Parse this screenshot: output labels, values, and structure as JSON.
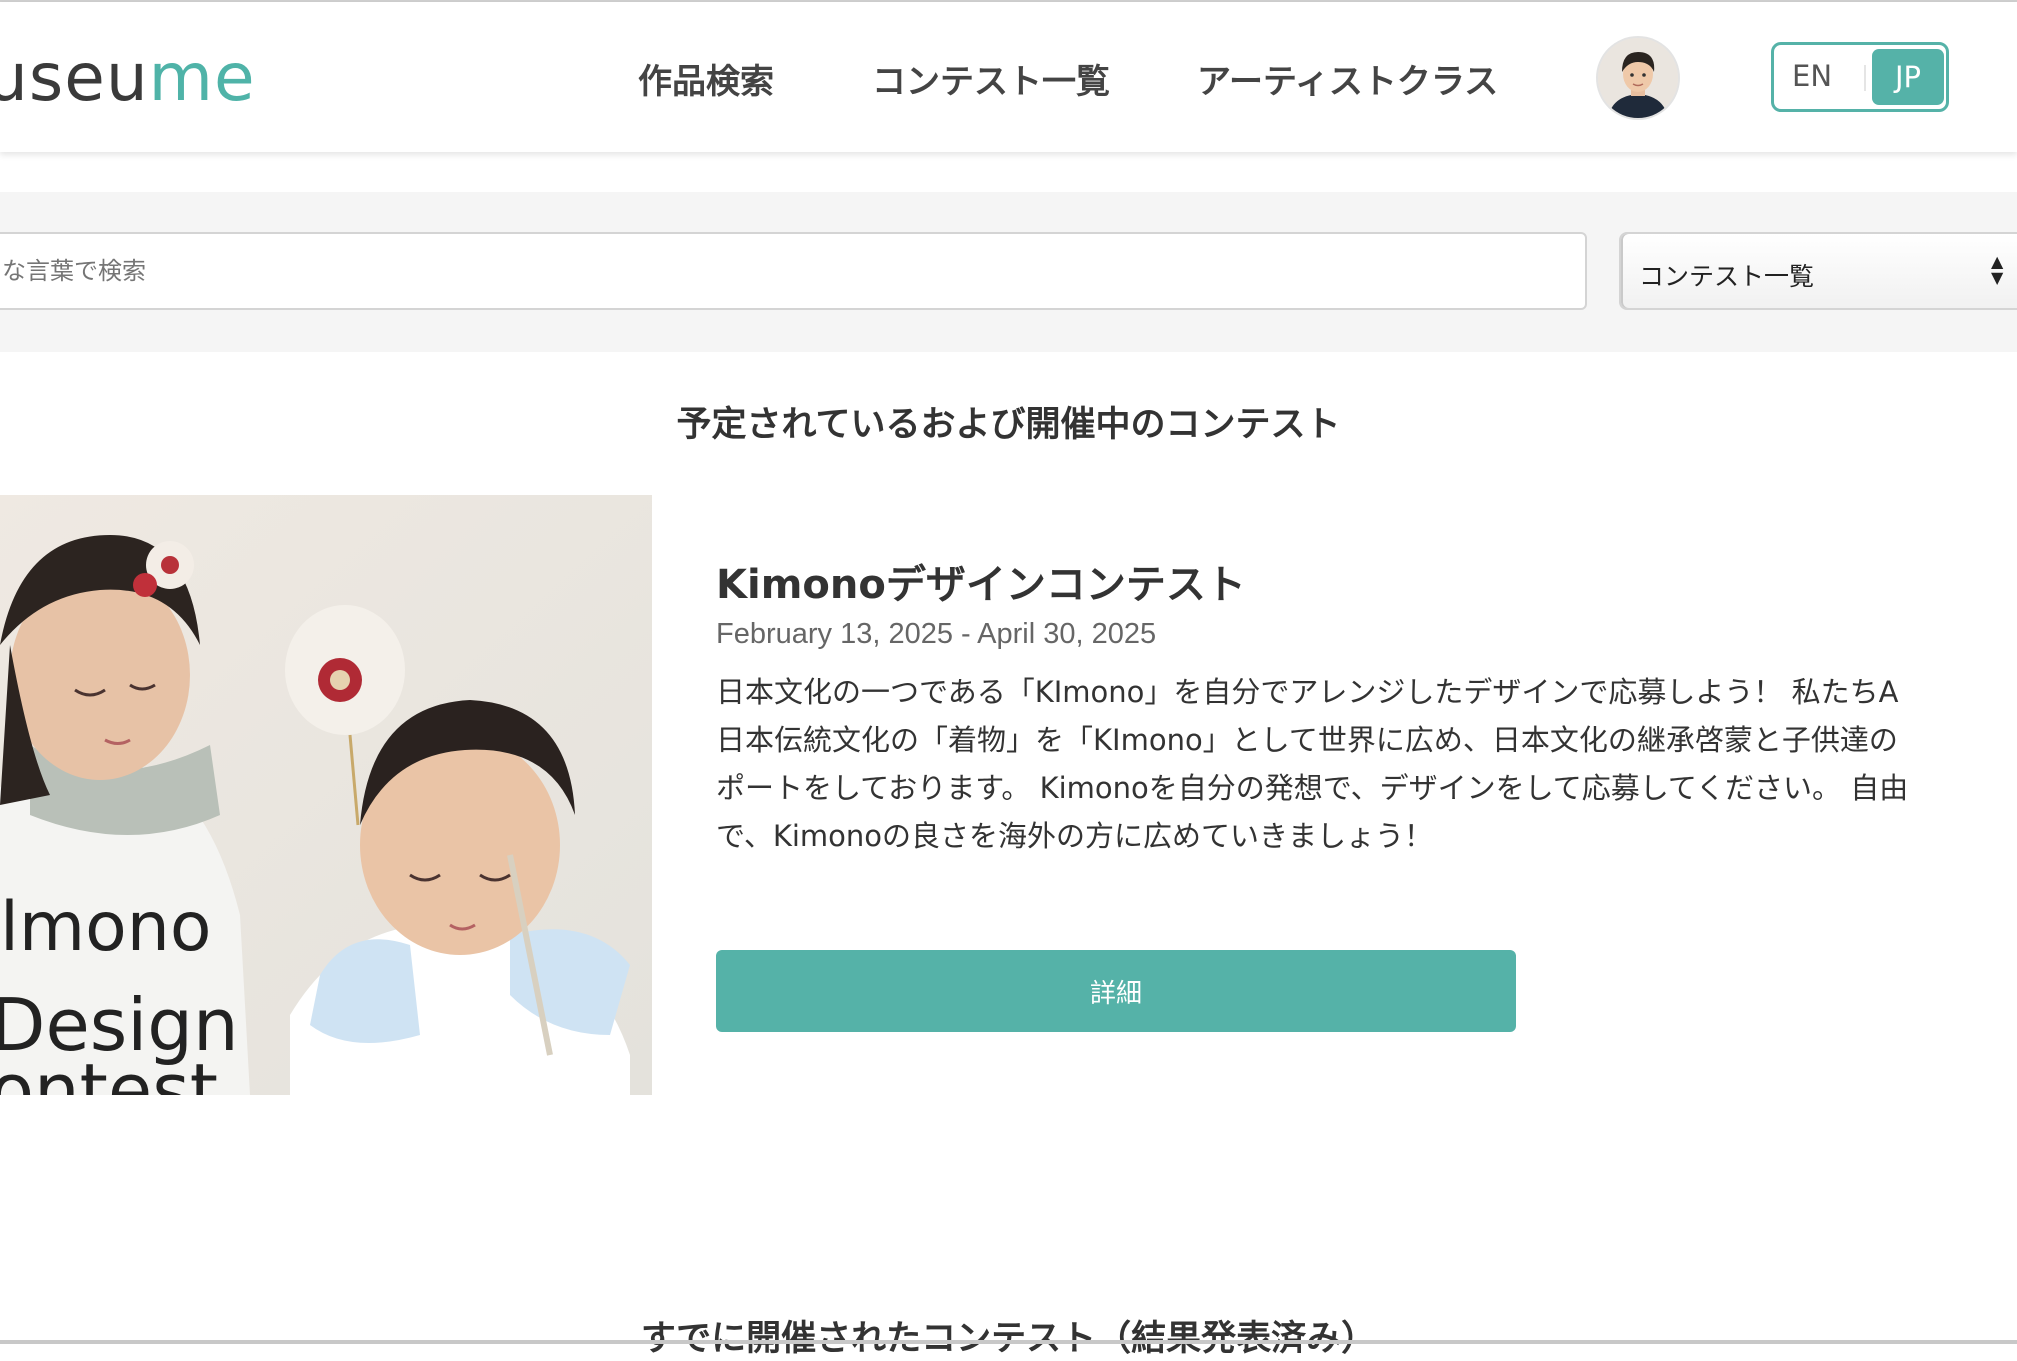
{
  "header": {
    "logo_prefix": "useu",
    "logo_suffix": "me",
    "nav": [
      "作品検索",
      "コンテスト一覧",
      "アーティストクラス"
    ],
    "lang": {
      "en": "EN",
      "jp": "JP"
    }
  },
  "search": {
    "placeholder": "な言葉で検索",
    "select_value": "コンテスト一覧"
  },
  "sections": {
    "upcoming_title": "予定されているおよび開催中のコンテスト",
    "past_title": "すでに開催されたコンテスト（結果発表済み）"
  },
  "contest": {
    "image_text": [
      "lmono",
      "Design",
      "ontest"
    ],
    "title": "Kimonoデザインコンテスト",
    "dates": "February 13, 2025 - April 30, 2025",
    "description_lines": [
      "日本文化の一つである「KImono」を自分でアレンジしたデザインで応募しよう！ 私たちA",
      "日本伝統文化の「着物」を「KImono」として世界に広め、日本文化の継承啓蒙と子供達の",
      "ポートをしております。 Kimonoを自分の発想で、デザインをして応募してください。 自由",
      "で、Kimonoの良さを海外の方に広めていきましょう！"
    ],
    "detail_button": "詳細"
  },
  "colors": {
    "accent": "#55b2a8",
    "logo_accent": "#4fb3a8"
  }
}
